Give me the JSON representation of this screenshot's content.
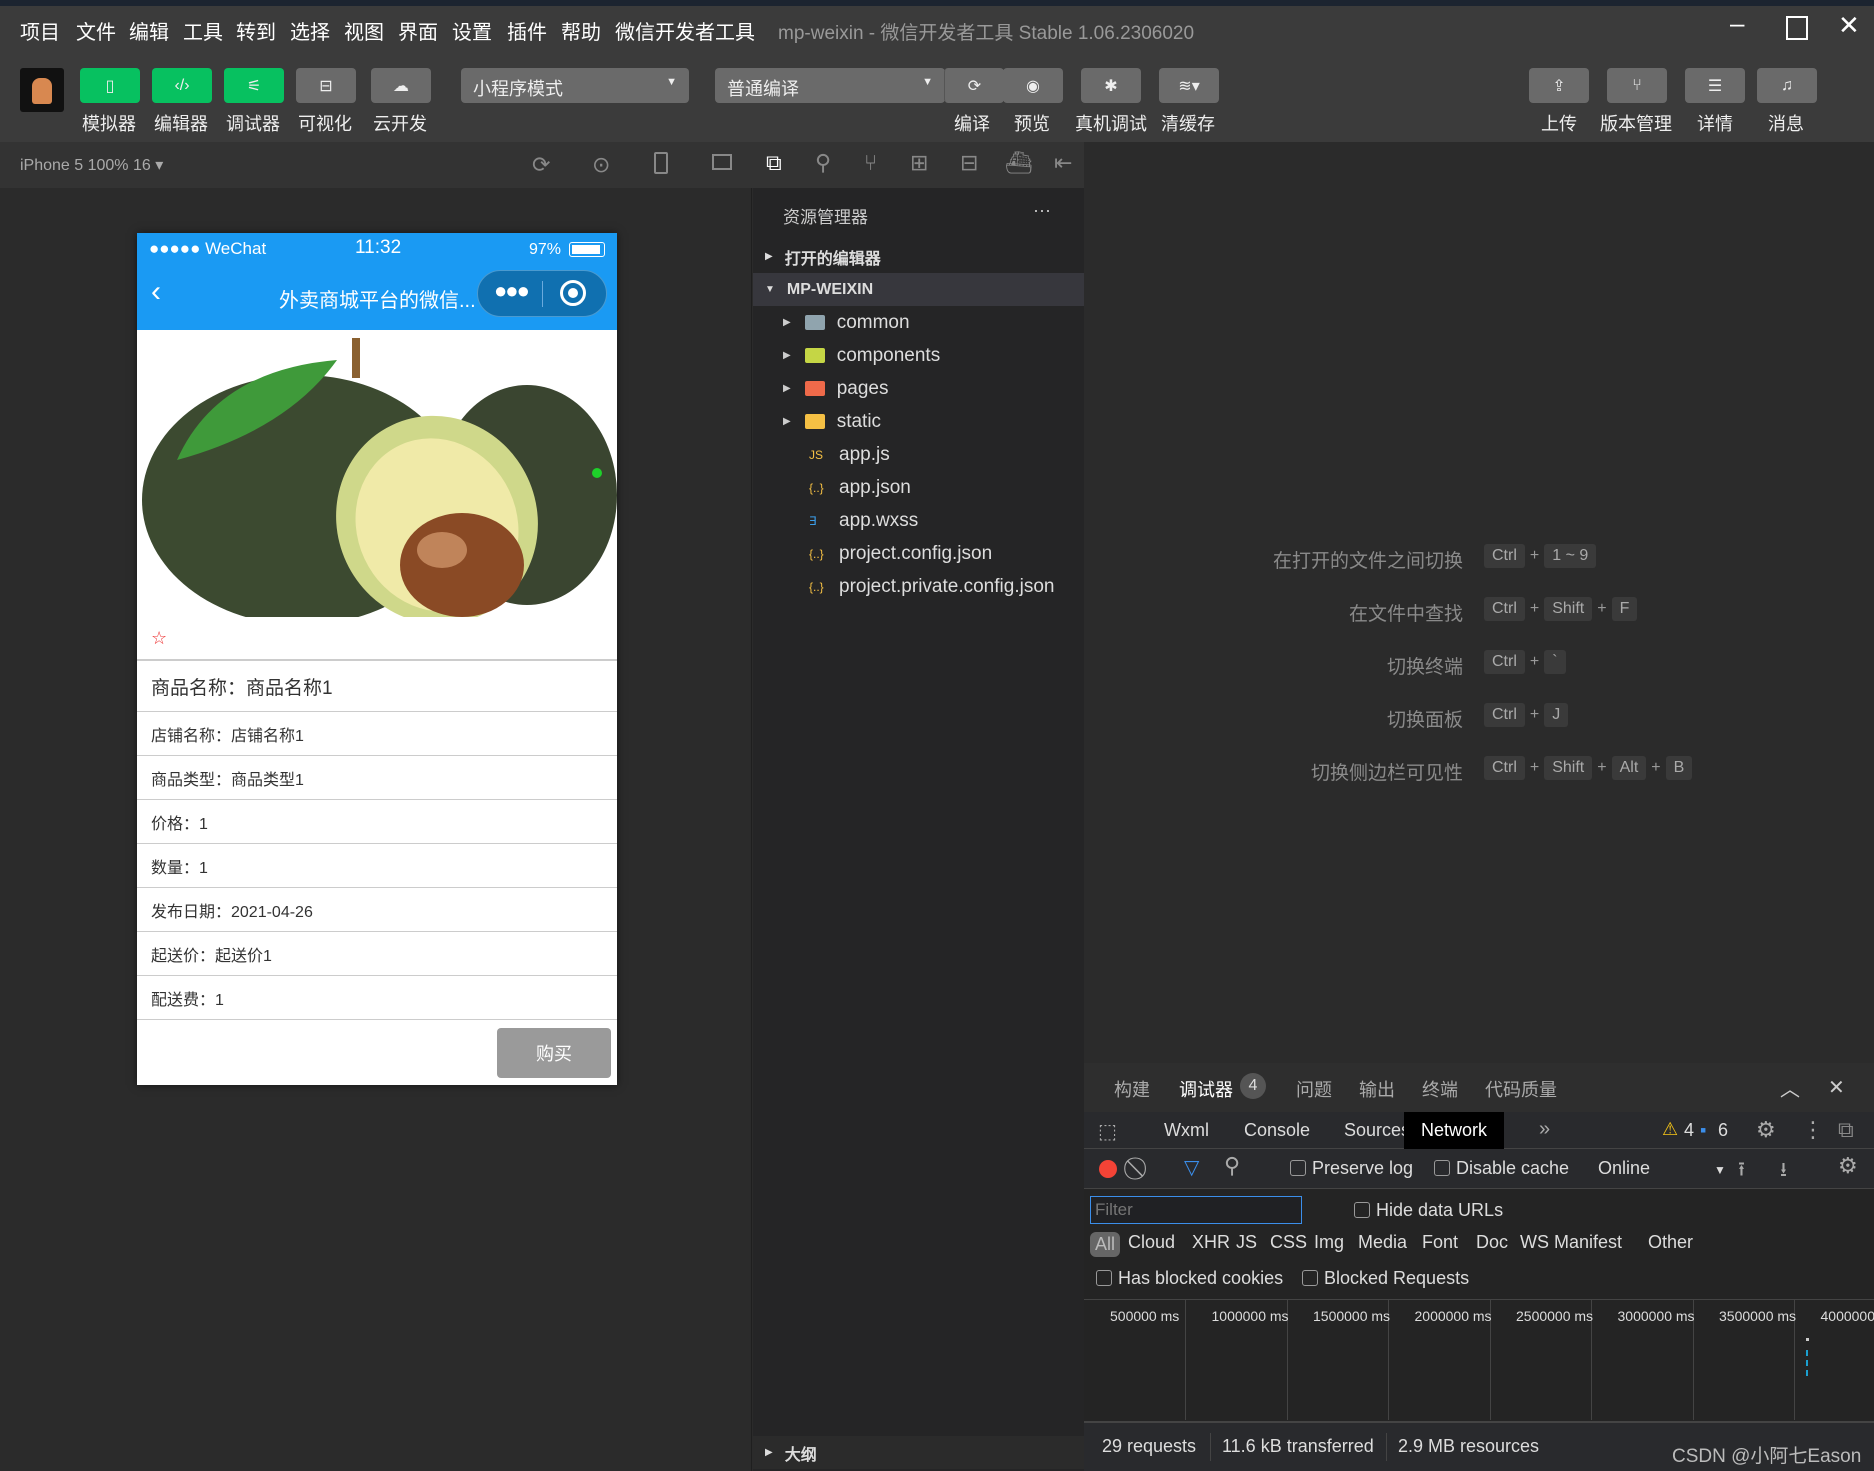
{
  "menu": [
    "项目",
    "文件",
    "编辑",
    "工具",
    "转到",
    "选择",
    "视图",
    "界面",
    "设置",
    "插件",
    "帮助",
    "微信开发者工具"
  ],
  "window_title": "mp-weixin - 微信开发者工具 Stable 1.06.2306020",
  "toolbar": {
    "left": [
      "模拟器",
      "编辑器",
      "调试器",
      "可视化",
      "云开发"
    ],
    "mode": "小程序模式",
    "compile": "普通编译",
    "mid": [
      "编译",
      "预览",
      "真机调试",
      "清缓存"
    ],
    "right": [
      "上传",
      "版本管理",
      "详情",
      "消息"
    ]
  },
  "device": "iPhone 5 100% 16 ▾",
  "phone": {
    "carrier": "●●●●● WeChat",
    "time": "11:32",
    "battery": "97%",
    "title": "外卖商城平台的微信...",
    "star": "☆",
    "name": "商品名称：商品名称1",
    "rows": [
      "店铺名称：店铺名称1",
      "商品类型：商品类型1",
      "价格：1",
      "数量：1",
      "发布日期：2021-04-26",
      "起送价：起送价1",
      "配送费：1"
    ],
    "buy": "购买"
  },
  "explorer": {
    "title": "资源管理器",
    "more": "···",
    "open_editors": "打开的编辑器",
    "root": "MP-WEIXIN",
    "folders": [
      "common",
      "components",
      "pages",
      "static"
    ],
    "files": [
      "app.js",
      "app.json",
      "app.wxss",
      "project.config.json",
      "project.private.config.json"
    ],
    "outline": "大纲"
  },
  "shortcuts": [
    {
      "label": "在打开的文件之间切换",
      "keys": [
        "Ctrl",
        "1 ~ 9"
      ]
    },
    {
      "label": "在文件中查找",
      "keys": [
        "Ctrl",
        "Shift",
        "F"
      ]
    },
    {
      "label": "切换终端",
      "keys": [
        "Ctrl",
        "`"
      ]
    },
    {
      "label": "切换面板",
      "keys": [
        "Ctrl",
        "J"
      ]
    },
    {
      "label": "切换侧边栏可见性",
      "keys": [
        "Ctrl",
        "Shift",
        "Alt",
        "B"
      ]
    }
  ],
  "panel": {
    "tabs": [
      "构建",
      "调试器",
      "问题",
      "输出",
      "终端",
      "代码质量"
    ],
    "debugger_badge": "4",
    "devtools_tabs": [
      "Wxml",
      "Console",
      "Sources",
      "Network"
    ],
    "active_tab": "Network",
    "warnings": "4",
    "messages": "6",
    "preserve_log": "Preserve log",
    "disable_cache": "Disable cache",
    "throttle": "Online",
    "filter_placeholder": "Filter",
    "hide_data_urls": "Hide data URLs",
    "types": [
      "All",
      "Cloud",
      "XHR",
      "JS",
      "CSS",
      "Img",
      "Media",
      "Font",
      "Doc",
      "WS",
      "Manifest",
      "Other"
    ],
    "blocked_cookies": "Has blocked cookies",
    "blocked_requests": "Blocked Requests",
    "timeline": [
      "500000 ms",
      "1000000 ms",
      "1500000 ms",
      "2000000 ms",
      "2500000 ms",
      "3000000 ms",
      "3500000 ms",
      "4000000"
    ],
    "status": [
      "29 requests",
      "11.6 kB transferred",
      "2.9 MB resources"
    ]
  },
  "watermark": "CSDN @小阿七Eason",
  "colors": {
    "accent_green": "#07c160",
    "wechat_blue": "#1a9af3",
    "record_red": "#f44336"
  }
}
